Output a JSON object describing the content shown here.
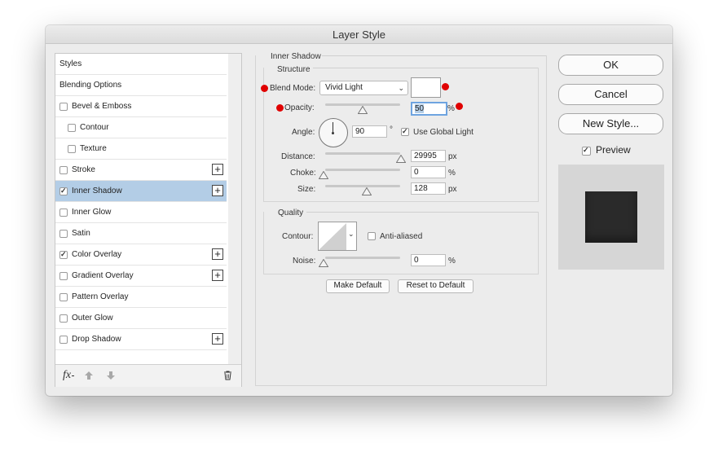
{
  "window": {
    "title": "Layer Style"
  },
  "styles_list": {
    "items": [
      {
        "label": "Styles",
        "checkbox": false,
        "checked": false,
        "plus": false,
        "selected": false,
        "indent": 0
      },
      {
        "label": "Blending Options",
        "checkbox": false,
        "checked": false,
        "plus": false,
        "selected": false,
        "indent": 0
      },
      {
        "label": "Bevel & Emboss",
        "checkbox": true,
        "checked": false,
        "plus": false,
        "selected": false,
        "indent": 0
      },
      {
        "label": "Contour",
        "checkbox": true,
        "checked": false,
        "plus": false,
        "selected": false,
        "indent": 1
      },
      {
        "label": "Texture",
        "checkbox": true,
        "checked": false,
        "plus": false,
        "selected": false,
        "indent": 1
      },
      {
        "label": "Stroke",
        "checkbox": true,
        "checked": false,
        "plus": true,
        "selected": false,
        "indent": 0
      },
      {
        "label": "Inner Shadow",
        "checkbox": true,
        "checked": true,
        "plus": true,
        "selected": true,
        "indent": 0
      },
      {
        "label": "Inner Glow",
        "checkbox": true,
        "checked": false,
        "plus": false,
        "selected": false,
        "indent": 0
      },
      {
        "label": "Satin",
        "checkbox": true,
        "checked": false,
        "plus": false,
        "selected": false,
        "indent": 0
      },
      {
        "label": "Color Overlay",
        "checkbox": true,
        "checked": true,
        "plus": true,
        "selected": false,
        "indent": 0
      },
      {
        "label": "Gradient Overlay",
        "checkbox": true,
        "checked": false,
        "plus": true,
        "selected": false,
        "indent": 0
      },
      {
        "label": "Pattern Overlay",
        "checkbox": true,
        "checked": false,
        "plus": false,
        "selected": false,
        "indent": 0
      },
      {
        "label": "Outer Glow",
        "checkbox": true,
        "checked": false,
        "plus": false,
        "selected": false,
        "indent": 0
      },
      {
        "label": "Drop Shadow",
        "checkbox": true,
        "checked": false,
        "plus": true,
        "selected": false,
        "indent": 0
      }
    ],
    "footer": {
      "fx_label": "fx",
      "icons": [
        "move-up-icon",
        "move-down-icon",
        "trash-icon"
      ]
    }
  },
  "inner_shadow": {
    "section_title": "Inner Shadow",
    "structure": {
      "title": "Structure",
      "blend_mode": {
        "label": "Blend Mode:",
        "value": "Vivid Light"
      },
      "shadow_color": "#ffffff",
      "opacity": {
        "label": "Opacity:",
        "value": "50",
        "unit": "%",
        "slider_fraction": 0.5
      },
      "angle": {
        "label": "Angle:",
        "value": "90",
        "unit": "°",
        "use_global_light_label": "Use Global Light",
        "use_global_light_checked": true
      },
      "distance": {
        "label": "Distance:",
        "value": "29995",
        "unit": "px",
        "slider_fraction": 1.0
      },
      "choke": {
        "label": "Choke:",
        "value": "0",
        "unit": "%",
        "slider_fraction": 0.0
      },
      "size": {
        "label": "Size:",
        "value": "128",
        "unit": "px",
        "slider_fraction": 0.51
      }
    },
    "quality": {
      "title": "Quality",
      "contour_label": "Contour:",
      "anti_aliased_label": "Anti-aliased",
      "anti_aliased_checked": false,
      "noise": {
        "label": "Noise:",
        "value": "0",
        "unit": "%",
        "slider_fraction": 0.0
      }
    },
    "make_default_label": "Make Default",
    "reset_default_label": "Reset to Default"
  },
  "buttons": {
    "ok": "OK",
    "cancel": "Cancel",
    "new_style": "New Style..."
  },
  "preview": {
    "label": "Preview",
    "checked": true,
    "swatch_color": "#2a2a2a"
  },
  "annotations": {
    "dot_color": "#e00000"
  }
}
